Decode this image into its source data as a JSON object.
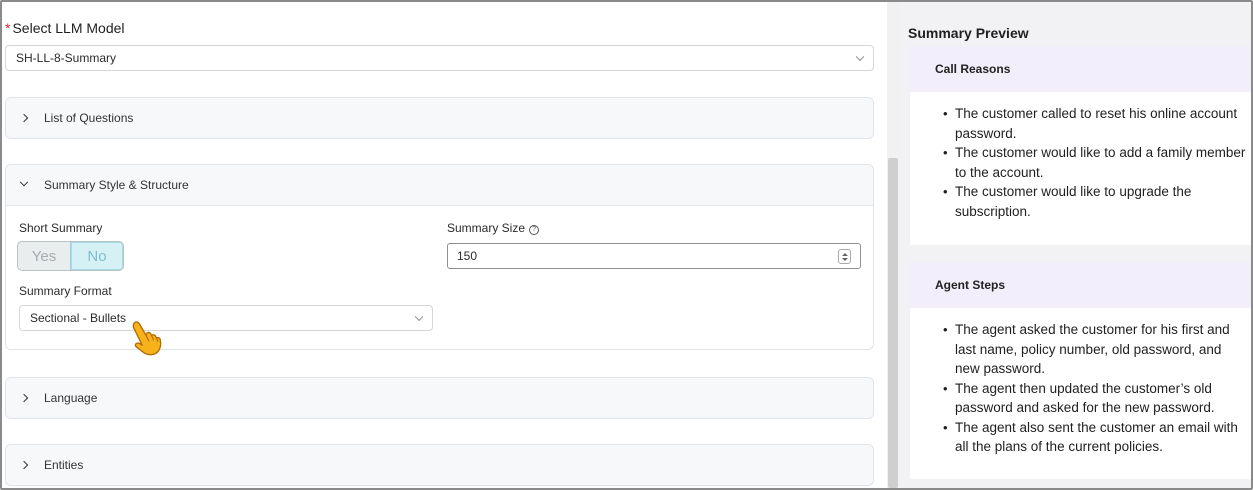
{
  "form": {
    "llm_model": {
      "required_mark": "*",
      "label": "Select LLM Model",
      "value": "SH-LL-8-Summary"
    },
    "sections": [
      {
        "label": "List of Questions",
        "expanded": false
      },
      {
        "label": "Summary Style & Structure",
        "expanded": true
      },
      {
        "label": "Language",
        "expanded": false
      },
      {
        "label": "Entities",
        "expanded": false
      }
    ],
    "style_structure": {
      "short_summary_label": "Short Summary",
      "toggle_yes": "Yes",
      "toggle_no": "No",
      "toggle_selected": "No",
      "summary_size_label": "Summary Size",
      "summary_size_value": "150",
      "summary_format_label": "Summary Format",
      "summary_format_value": "Sectional - Bullets"
    }
  },
  "preview": {
    "title": "Summary Preview",
    "cards": [
      {
        "heading": "Call Reasons",
        "bullets": [
          "The customer called to reset his online account password.",
          "The customer would like to add a family member to the account.",
          "The customer would like to upgrade the subscription."
        ]
      },
      {
        "heading": "Agent Steps",
        "bullets": [
          "The agent asked the customer for his first and last name, policy number, old password, and new password.",
          "The agent then updated the customer’s old password and asked for the new password.",
          "The agent also sent the customer an email with all the plans of the current policies."
        ]
      }
    ]
  },
  "icons": {
    "help": "help-circle-icon",
    "pointer": "hand-pointer-icon",
    "chevron": "chevron-down-icon"
  },
  "colors": {
    "required": "#e0252a",
    "toggle_active_bg": "#d6f1f6",
    "card_header_bg": "#f3eefb"
  }
}
